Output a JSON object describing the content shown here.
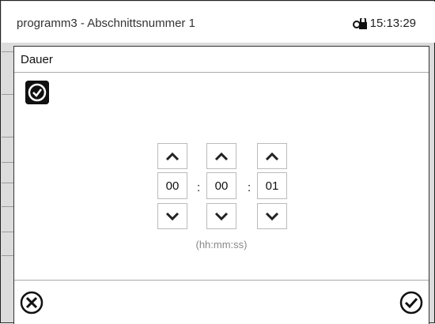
{
  "header": {
    "title": "programm3 - Abschnittsnummer 1",
    "time": "15:13:29"
  },
  "dialog": {
    "title": "Dauer",
    "icon": "clock-icon",
    "time_fields": [
      {
        "name": "hours",
        "value": "00"
      },
      {
        "name": "minutes",
        "value": "00"
      },
      {
        "name": "seconds",
        "value": "01"
      }
    ],
    "separator": ":",
    "format_hint": "(hh:mm:ss)"
  },
  "footer": {
    "cancel_icon": "cancel-icon",
    "confirm_icon": "confirm-icon"
  }
}
